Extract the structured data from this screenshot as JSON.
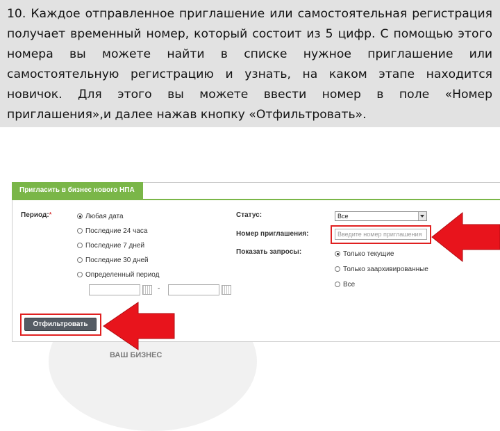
{
  "caption": {
    "text": "10. Каждое отправленное приглашение или самостоятельная регистрация получает временный номер, который состоит из 5 цифр. С помощью этого номера вы можете найти в списке нужное приглашение или самостоятельную регистрацию и узнать, на каком этапе находится новичок. Для этого вы можете ввести номер в поле «Номер приглашения»,и далее нажав кнопку «Отфильтровать»."
  },
  "panel": {
    "tab_label": "Пригласить в бизнес нового НПА",
    "period": {
      "label": "Период:",
      "required_mark": "*",
      "options": [
        {
          "label": "Любая дата",
          "checked": true
        },
        {
          "label": "Последние 24 часа",
          "checked": false
        },
        {
          "label": "Последние 7 дней",
          "checked": false
        },
        {
          "label": "Последние 30 дней",
          "checked": false
        },
        {
          "label": "Определенный период",
          "checked": false
        }
      ],
      "range_separator": "-"
    },
    "status": {
      "label": "Статус:",
      "selected": "Все"
    },
    "invite_number": {
      "label": "Номер приглашения:",
      "placeholder": "Введите номер приглашения"
    },
    "show_requests": {
      "label": "Показать запросы:",
      "options": [
        {
          "label": "Только текущие",
          "checked": true
        },
        {
          "label": "Только заархивированные",
          "checked": false
        },
        {
          "label": "Все",
          "checked": false
        }
      ]
    },
    "filter_button": "Отфильтровать"
  },
  "watermark": {
    "text": "ВАШ БИЗНЕС"
  },
  "colors": {
    "caption_bg": "#e2e2e2",
    "tab_green": "#7ab648",
    "highlight_red": "#e02020",
    "arrow_red": "#e8141c",
    "button_gray": "#555c64"
  }
}
